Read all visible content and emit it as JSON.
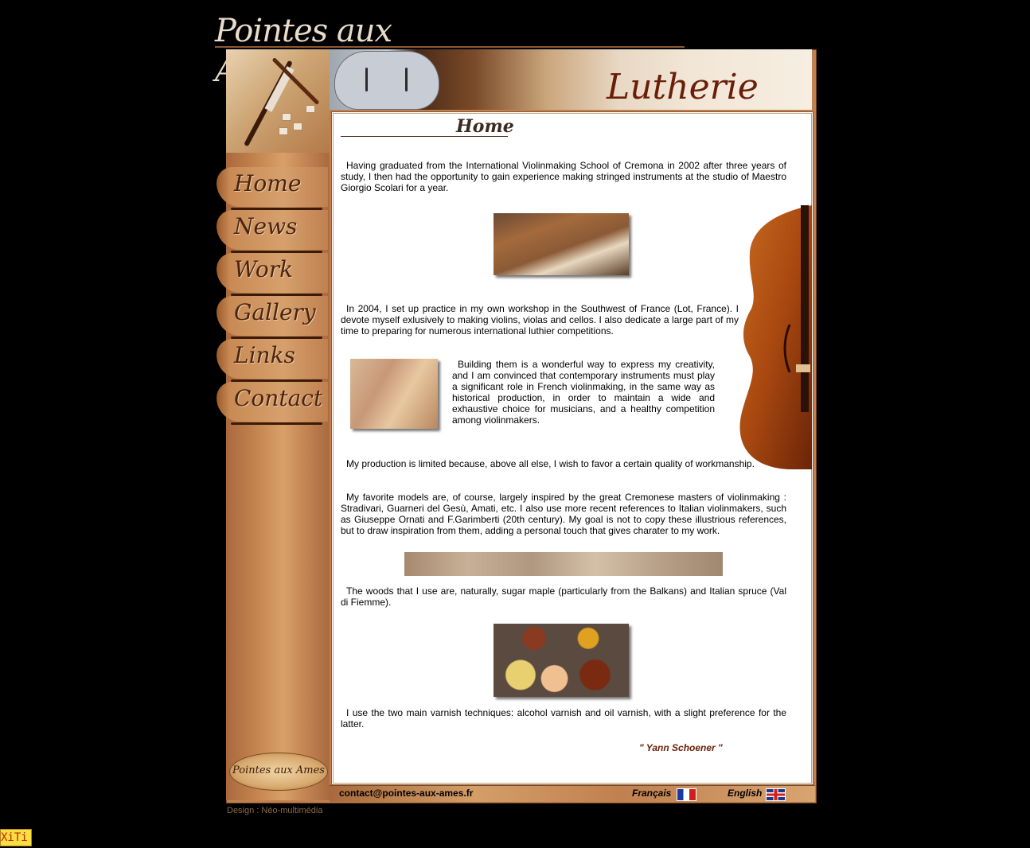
{
  "site": {
    "logo_text": "Pointes aux Ames",
    "banner_title": "Lutherie",
    "bottom_logo": "Pointes aux Ames"
  },
  "nav": {
    "items": [
      {
        "label": "Home"
      },
      {
        "label": "News"
      },
      {
        "label": "Work"
      },
      {
        "label": "Gallery"
      },
      {
        "label": "Links"
      },
      {
        "label": "Contact"
      }
    ]
  },
  "page": {
    "title": "Home",
    "paragraphs": [
      "Having graduated from the International Violinmaking School of Cremona in 2002 after three years of study, I then had the opportunity to gain experience making stringed instruments at the studio of Maestro Giorgio Scolari for a year.",
      "In 2004, I set up practice in my own workshop in the Southwest of France (Lot, France). I devote myself exlusively to making violins, violas and cellos. I also dedicate a large part of my time to preparing for numerous international luthier competitions.",
      "Building them is a wonderful way to express my creativity, and I am convinced that contemporary instruments must play a significant role in French violinmaking, in the same way as historical production, in order to maintain a wide and exhaustive choice for musicians, and a healthy competition among violinmakers.",
      "My production is limited because, above all else, I wish to favor a certain quality of workmanship.",
      "My favorite models are, of course, largely inspired by the great Cremonese masters of violinmaking : Stradivari, Guarneri del Gesù, Amati, etc. I also use more recent references to Italian violinmakers, such as Giuseppe Ornati and F.Garimberti (20th century). My goal is not to copy these illustrious references, but to draw inspiration from them, adding a personal touch that gives charater to my work.",
      "The woods that I use are, naturally, sugar maple (particularly from the Balkans) and Italian spruce (Val di Fiemme).",
      "I use the two main varnish techniques: alcohol varnish and oil varnish, with a slight preference for the latter."
    ],
    "signature": "\" Yann Schoener \""
  },
  "footer": {
    "email": "contact@pointes-aux-ames.fr",
    "lang_fr": "Français",
    "lang_en": "English",
    "design_credit": "Design : Néo-multimédia"
  },
  "badge": {
    "xiti": "XiTi"
  }
}
